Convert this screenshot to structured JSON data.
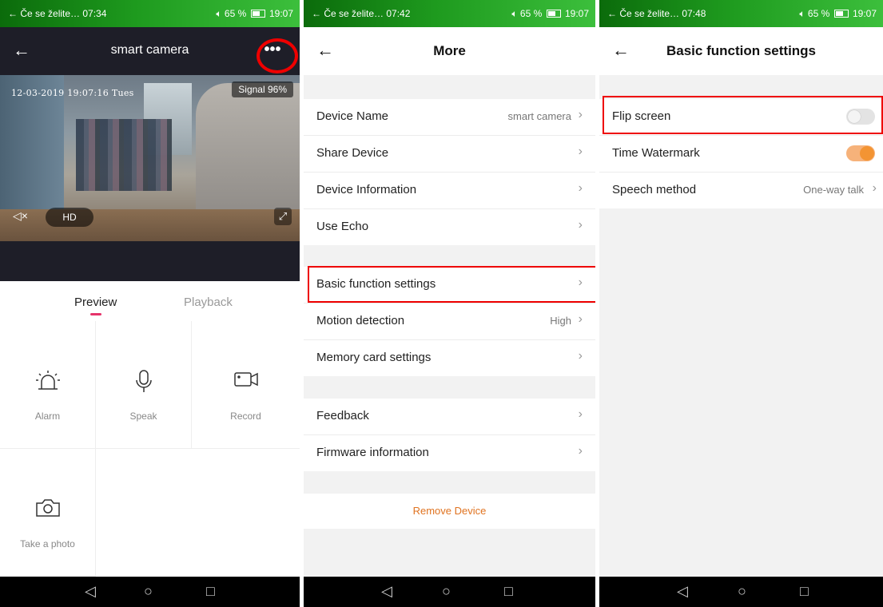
{
  "status_bars": [
    {
      "left": "← Če se želite… 07:34",
      "right": "65 %",
      "time": "19:07"
    },
    {
      "left": "← Če se želite… 07:42",
      "right": "65 %",
      "time": "19:07"
    },
    {
      "left": "← Če se želite… 07:48",
      "right": "65 %",
      "time": "19:07"
    }
  ],
  "screen1": {
    "title": "smart camera",
    "more_label": "•••",
    "video": {
      "timestamp": "12-03-2019 19:07:16 Tues",
      "signal": "Signal 96%",
      "quality": "HD"
    },
    "tabs": [
      {
        "label": "Preview",
        "active": true
      },
      {
        "label": "Playback",
        "active": false
      }
    ],
    "actions": [
      {
        "label": "Alarm",
        "icon": "alarm-icon"
      },
      {
        "label": "Speak",
        "icon": "microphone-icon"
      },
      {
        "label": "Record",
        "icon": "video-record-icon"
      },
      {
        "label": "Take a photo",
        "icon": "camera-icon"
      }
    ],
    "accent_color": "#e6336a"
  },
  "screen2": {
    "title": "More",
    "group1": [
      {
        "label": "Device Name",
        "value": "smart camera"
      },
      {
        "label": "Share Device",
        "value": ""
      },
      {
        "label": "Device Information",
        "value": ""
      },
      {
        "label": "Use Echo",
        "value": ""
      }
    ],
    "group2": [
      {
        "label": "Basic function settings",
        "value": ""
      },
      {
        "label": "Motion detection",
        "value": "High"
      },
      {
        "label": "Memory card settings",
        "value": ""
      }
    ],
    "group3": [
      {
        "label": "Feedback",
        "value": ""
      },
      {
        "label": "Firmware information",
        "value": ""
      }
    ],
    "remove_label": "Remove Device",
    "remove_color": "#e07320"
  },
  "screen3": {
    "title": "Basic function settings",
    "rows": [
      {
        "label": "Flip screen",
        "toggle": false
      },
      {
        "label": "Time Watermark",
        "toggle": true
      },
      {
        "label": "Speech method",
        "value": "One-way talk"
      }
    ],
    "toggle_on_color": "#f39433"
  },
  "highlight_color": "#e00000"
}
